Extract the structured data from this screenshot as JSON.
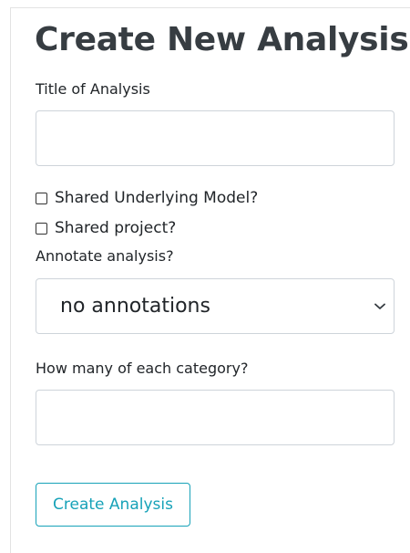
{
  "form": {
    "heading": "Create New Analysis",
    "title_label": "Title of Analysis",
    "title_value": "",
    "shared_model_label": "Shared Underlying Model?",
    "shared_model_checked": false,
    "shared_project_label": "Shared project?",
    "shared_project_checked": false,
    "annotate_label": "Annotate analysis?",
    "annotate_selected": "no annotations",
    "category_count_label": "How many of each category?",
    "category_count_value": "",
    "submit_label": "Create Analysis"
  },
  "colors": {
    "accent": "#17a2b8",
    "border": "#ced4da",
    "heading": "#373d42"
  },
  "icons": {
    "select_chevron": "chevron-down-icon"
  }
}
